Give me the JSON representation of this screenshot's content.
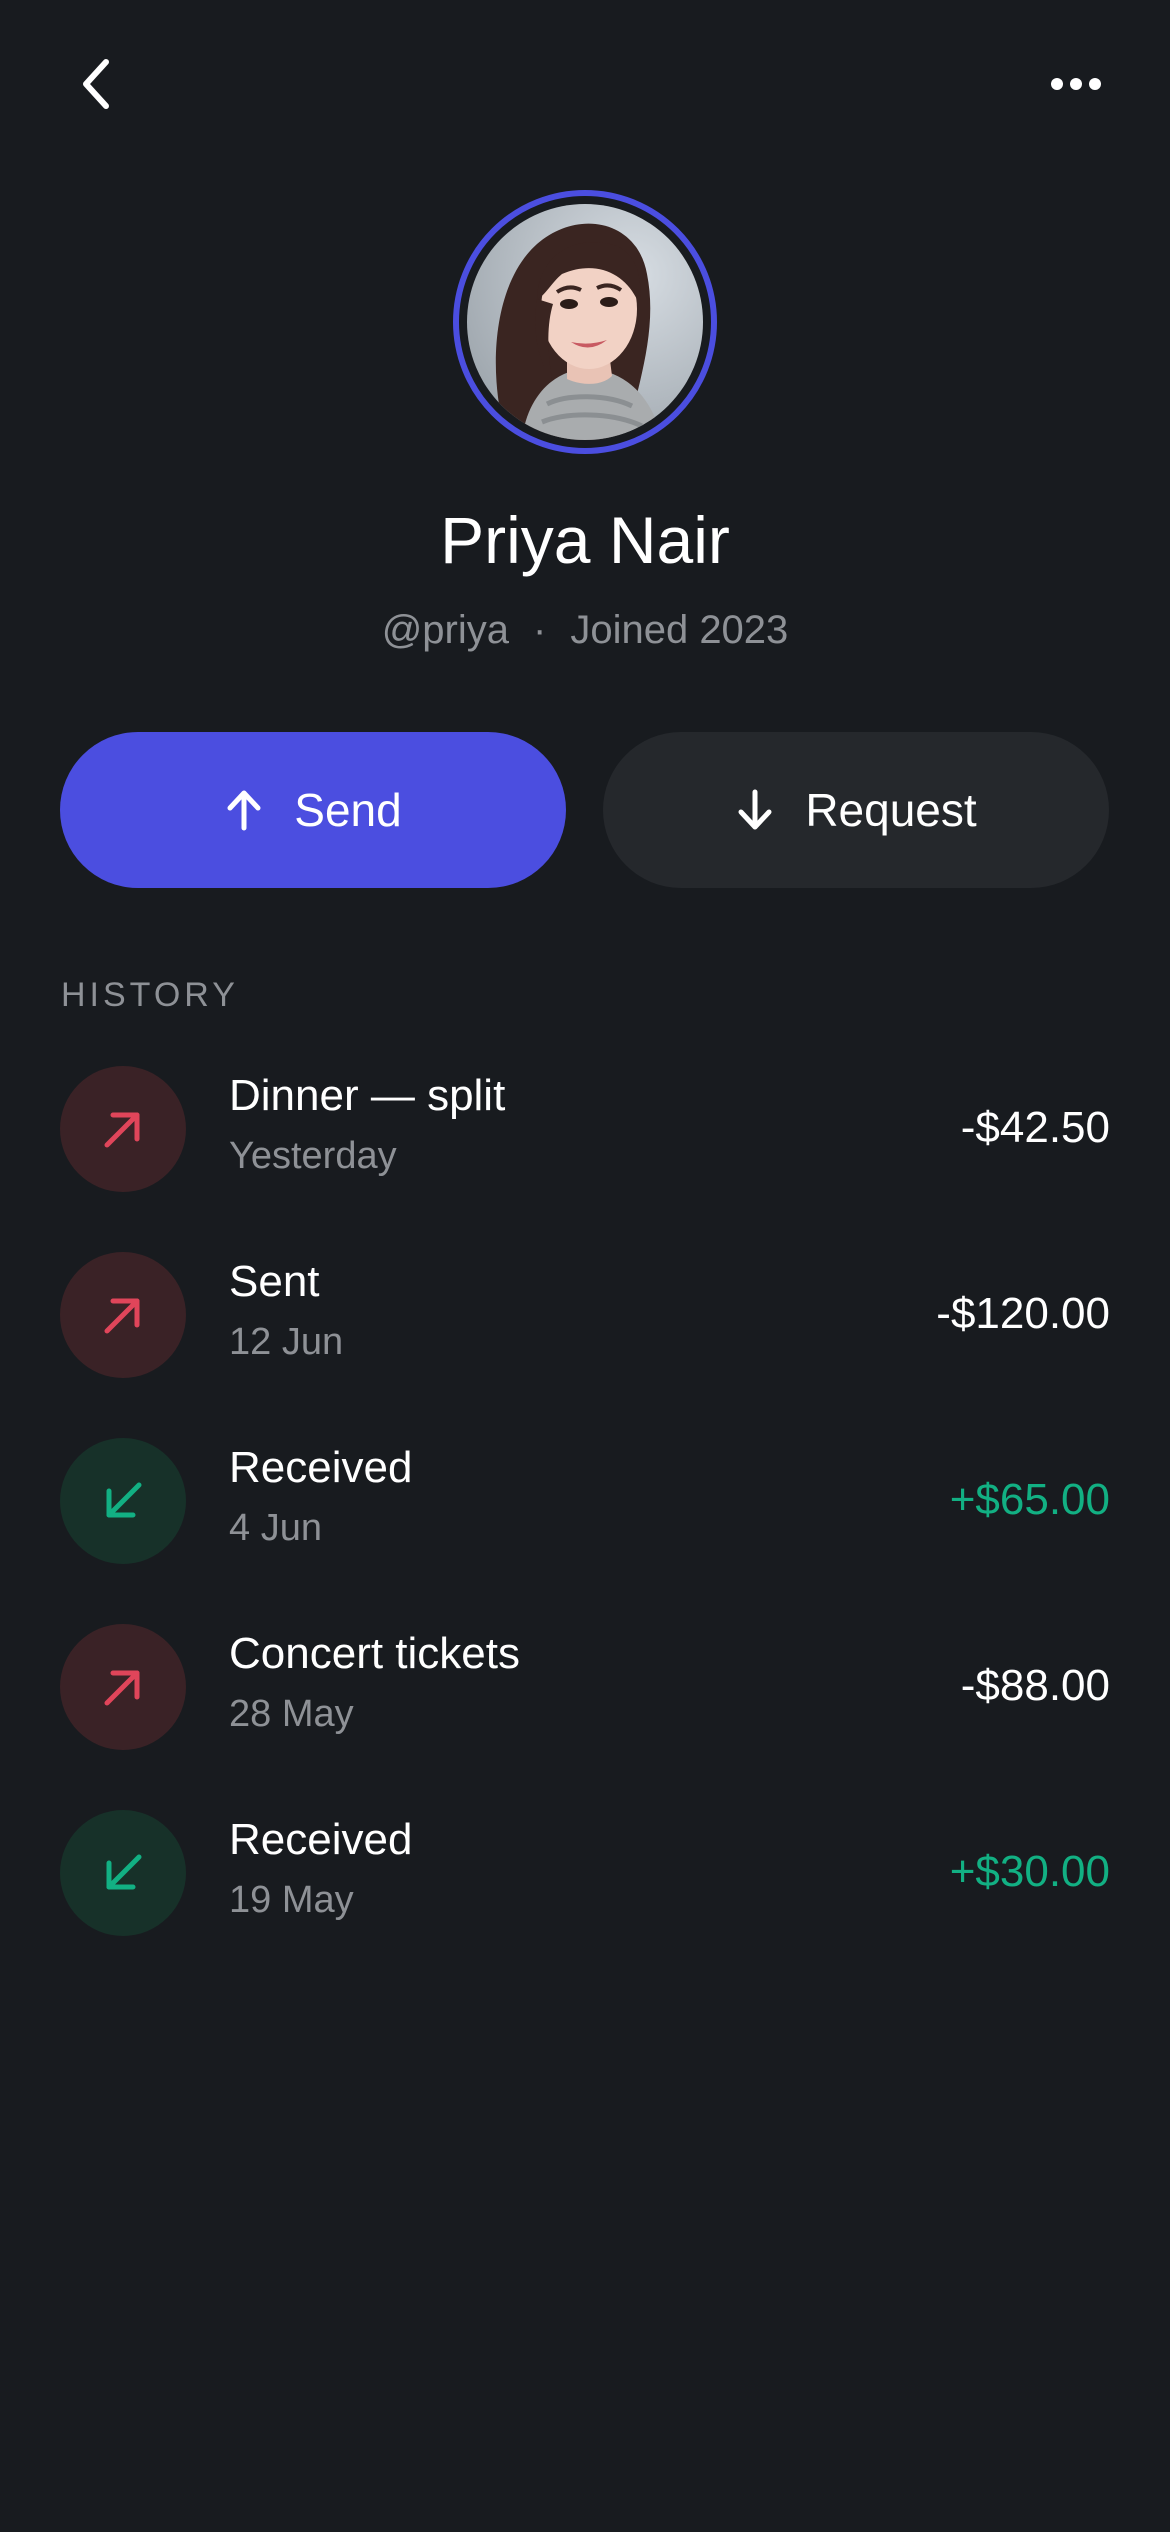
{
  "topbar": {
    "back_icon": "chevron-left-icon",
    "more_icon": "more-horizontal-icon"
  },
  "profile": {
    "name": "Priya Nair",
    "handle": "@priya",
    "separator": "·",
    "joined": "Joined 2023",
    "ring_color": "#4b4ee0"
  },
  "actions": {
    "send_label": "Send",
    "send_icon": "arrow-up-icon",
    "request_label": "Request",
    "request_icon": "arrow-down-icon"
  },
  "history": {
    "label": "HISTORY",
    "items": [
      {
        "title": "Dinner — split",
        "date": "Yesterday",
        "amount": "-$42.50",
        "direction": "out"
      },
      {
        "title": "Sent",
        "date": "12 Jun",
        "amount": "-$120.00",
        "direction": "out"
      },
      {
        "title": "Received",
        "date": "4 Jun",
        "amount": "+$65.00",
        "direction": "in"
      },
      {
        "title": "Concert tickets",
        "date": "28 May",
        "amount": "-$88.00",
        "direction": "out"
      },
      {
        "title": "Received",
        "date": "19 May",
        "amount": "+$30.00",
        "direction": "in"
      }
    ]
  },
  "colors": {
    "background": "#181b1f",
    "accent": "#4b4ee0",
    "outgoing": "#e0455a",
    "incoming": "#12b083",
    "muted_text": "#8e9196"
  }
}
